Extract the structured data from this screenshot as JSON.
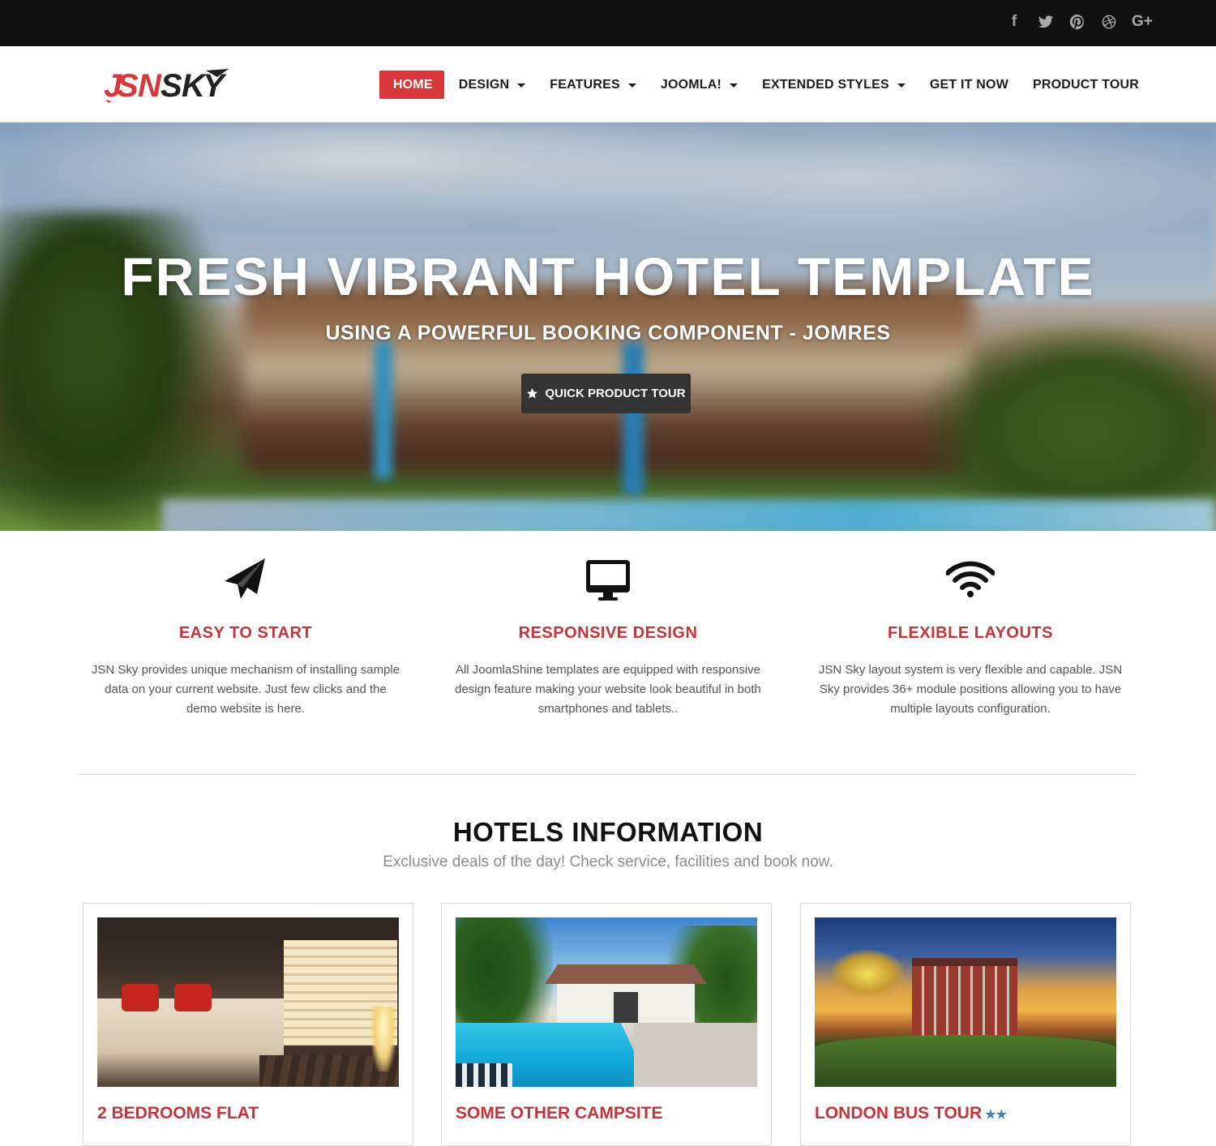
{
  "social": {
    "icons": [
      "facebook-icon",
      "twitter-icon",
      "pinterest-icon",
      "dribbble-icon",
      "google-plus-icon"
    ],
    "facebook_glyph": "f",
    "google_glyph": "G+"
  },
  "header": {
    "logo_text": "JSNSKY",
    "nav": [
      {
        "label": "HOME",
        "active": true,
        "dropdown": false
      },
      {
        "label": "DESIGN",
        "active": false,
        "dropdown": true
      },
      {
        "label": "FEATURES",
        "active": false,
        "dropdown": true
      },
      {
        "label": "JOOMLA!",
        "active": false,
        "dropdown": true
      },
      {
        "label": "EXTENDED STYLES",
        "active": false,
        "dropdown": true
      },
      {
        "label": "GET IT NOW",
        "active": false,
        "dropdown": false
      },
      {
        "label": "PRODUCT TOUR",
        "active": false,
        "dropdown": false
      }
    ]
  },
  "hero": {
    "title": "FRESH VIBRANT HOTEL TEMPLATE",
    "subtitle": "USING A POWERFUL BOOKING COMPONENT - JOMRES",
    "button_label": "QUICK PRODUCT TOUR",
    "button_icon": "star-icon"
  },
  "features": [
    {
      "icon": "paper-plane-icon",
      "title": "EASY TO START",
      "text": "JSN Sky provides unique mechanism of installing sample data on your current website. Just few clicks and the demo website is here."
    },
    {
      "icon": "desktop-icon",
      "title": "RESPONSIVE DESIGN",
      "text": "All JoomlaShine templates are equipped with responsive design feature making your website look beautiful in both smartphones and tablets.."
    },
    {
      "icon": "wifi-icon",
      "title": "FLEXIBLE LAYOUTS",
      "text": "JSN Sky layout system is very flexible and capable. JSN Sky provides 36+ module positions allowing you to have multiple layouts configuration."
    }
  ],
  "hotels": {
    "title": "HOTELS INFORMATION",
    "subtitle": "Exclusive deals of the day! Check service, facilities and book now.",
    "cards": [
      {
        "title": "2 BEDROOMS FLAT",
        "stars": ""
      },
      {
        "title": "SOME OTHER CAMPSITE",
        "stars": ""
      },
      {
        "title": "LONDON BUS TOUR",
        "stars": "★★"
      }
    ]
  },
  "colors": {
    "accent_red": "#d9383a",
    "feature_title_red": "#c73336",
    "topbar_bg": "#111111",
    "hero_button_bg": "#333333",
    "star_blue": "#3a86c8"
  }
}
